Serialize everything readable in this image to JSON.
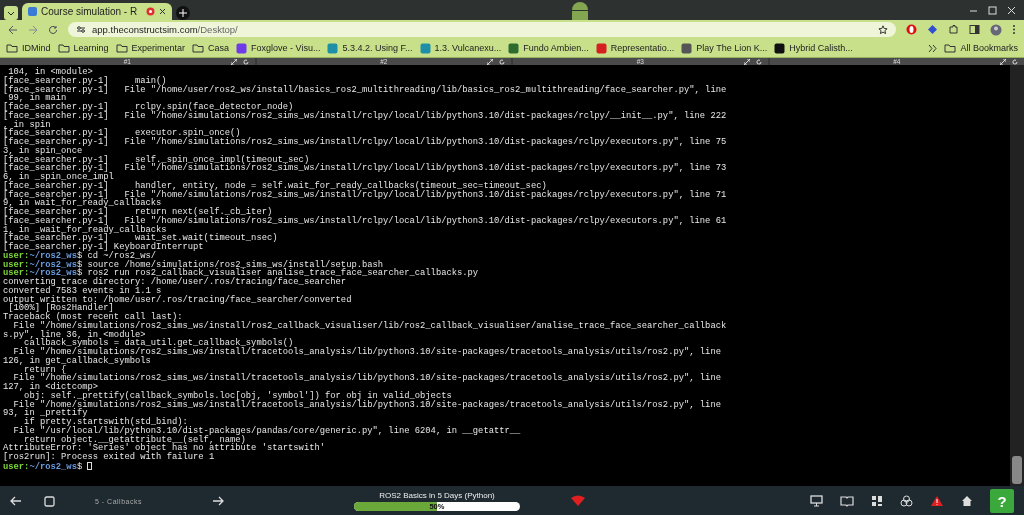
{
  "browser": {
    "tabs": [
      {
        "title": "Course simulation - R",
        "selected": true
      }
    ],
    "url_host": "app.theconstructsim.com",
    "url_path": "/Desktop/",
    "bookmarks": [
      {
        "label": "IDMind",
        "kind": "folder"
      },
      {
        "label": "Learning",
        "kind": "folder"
      },
      {
        "label": "Experimentar",
        "kind": "folder"
      },
      {
        "label": "Casa",
        "kind": "folder"
      },
      {
        "label": "Foxglove - Visu...",
        "kind": "site",
        "color": "#6f3be8"
      },
      {
        "label": "5.3.4.2. Using F...",
        "kind": "site",
        "color": "#1f8fa8"
      },
      {
        "label": "1.3. Vulcanexu...",
        "kind": "site",
        "color": "#1f8fa8"
      },
      {
        "label": "Fundo Ambien...",
        "kind": "site",
        "color": "#2e6b2e"
      },
      {
        "label": "Representatio...",
        "kind": "site",
        "color": "#d42020"
      },
      {
        "label": "Play The Lion K...",
        "kind": "site",
        "color": "#555555"
      },
      {
        "label": "Hybrid Calisth...",
        "kind": "site",
        "color": "#111111"
      }
    ],
    "all_bookmarks": "All Bookmarks"
  },
  "terminal_tabs": [
    {
      "label": "#1"
    },
    {
      "label": "#2"
    },
    {
      "label": "#3"
    },
    {
      "label": "#4"
    }
  ],
  "terminal": {
    "lines": [
      {
        "kind": "output",
        "text": " 104, in <module>"
      },
      {
        "kind": "output",
        "text": "[face_searcher.py-1]     main()"
      },
      {
        "kind": "output",
        "text": "[face_searcher.py-1]   File \"/home/user/ros2_ws/install/basics_ros2_multithreading/lib/basics_ros2_multithreading/face_searcher.py\", line"
      },
      {
        "kind": "output",
        "text": " 99, in main"
      },
      {
        "kind": "output",
        "text": "[face_searcher.py-1]     rclpy.spin(face_detector_node)"
      },
      {
        "kind": "output",
        "text": "[face_searcher.py-1]   File \"/home/simulations/ros2_sims_ws/install/rclpy/local/lib/python3.10/dist-packages/rclpy/__init__.py\", line 222"
      },
      {
        "kind": "output",
        "text": ", in spin"
      },
      {
        "kind": "output",
        "text": "[face_searcher.py-1]     executor.spin_once()"
      },
      {
        "kind": "output",
        "text": "[face_searcher.py-1]   File \"/home/simulations/ros2_sims_ws/install/rclpy/local/lib/python3.10/dist-packages/rclpy/executors.py\", line 75"
      },
      {
        "kind": "output",
        "text": "3, in spin_once"
      },
      {
        "kind": "output",
        "text": "[face_searcher.py-1]     self._spin_once_impl(timeout_sec)"
      },
      {
        "kind": "output",
        "text": "[face_searcher.py-1]   File \"/home/simulations/ros2_sims_ws/install/rclpy/local/lib/python3.10/dist-packages/rclpy/executors.py\", line 73"
      },
      {
        "kind": "output",
        "text": "6, in _spin_once_impl"
      },
      {
        "kind": "output",
        "text": "[face_searcher.py-1]     handler, entity, node = self.wait_for_ready_callbacks(timeout_sec=timeout_sec)"
      },
      {
        "kind": "output",
        "text": "[face_searcher.py-1]   File \"/home/simulations/ros2_sims_ws/install/rclpy/local/lib/python3.10/dist-packages/rclpy/executors.py\", line 71"
      },
      {
        "kind": "output",
        "text": "9, in wait_for_ready_callbacks"
      },
      {
        "kind": "output",
        "text": "[face_searcher.py-1]     return next(self._cb_iter)"
      },
      {
        "kind": "output",
        "text": "[face_searcher.py-1]   File \"/home/simulations/ros2_sims_ws/install/rclpy/local/lib/python3.10/dist-packages/rclpy/executors.py\", line 61"
      },
      {
        "kind": "output",
        "text": "1, in _wait_for_ready_callbacks"
      },
      {
        "kind": "output",
        "text": "[face_searcher.py-1]     wait_set.wait(timeout_nsec)"
      },
      {
        "kind": "output",
        "text": "[face_searcher.py-1] KeyboardInterrupt"
      },
      {
        "kind": "prompt",
        "user": "user:",
        "path": "~/ros2_ws",
        "command": "$ cd ~/ros2_ws/"
      },
      {
        "kind": "prompt",
        "user": "user:",
        "path": "~/ros2_ws",
        "command": "$ source /home/simulations/ros2_sims_ws/install/setup.bash"
      },
      {
        "kind": "prompt",
        "user": "user:",
        "path": "~/ros2_ws",
        "command": "$ ros2 run ros2_callback_visualiser analise_trace_face_searcher_callbacks.py"
      },
      {
        "kind": "output",
        "text": "converting trace directory: /home/user/.ros/tracing/face_searcher"
      },
      {
        "kind": "output",
        "text": "converted 7583 events in 1.1 s"
      },
      {
        "kind": "output",
        "text": "output written to: /home/user/.ros/tracing/face_searcher/converted"
      },
      {
        "kind": "output",
        "text": " [100%] [Ros2Handler]"
      },
      {
        "kind": "output",
        "text": "Traceback (most recent call last):"
      },
      {
        "kind": "output",
        "text": "  File \"/home/simulations/ros2_sims_ws/install/ros2_callback_visualiser/lib/ros2_callback_visualiser/analise_trace_face_searcher_callback"
      },
      {
        "kind": "output",
        "text": "s.py\", line 36, in <module>"
      },
      {
        "kind": "output",
        "text": "    callback_symbols = data_util.get_callback_symbols()"
      },
      {
        "kind": "output",
        "text": "  File \"/home/simulations/ros2_sims_ws/install/tracetools_analysis/lib/python3.10/site-packages/tracetools_analysis/utils/ros2.py\", line"
      },
      {
        "kind": "output",
        "text": "126, in get_callback_symbols"
      },
      {
        "kind": "output",
        "text": "    return {"
      },
      {
        "kind": "output",
        "text": "  File \"/home/simulations/ros2_sims_ws/install/tracetools_analysis/lib/python3.10/site-packages/tracetools_analysis/utils/ros2.py\", line"
      },
      {
        "kind": "output",
        "text": "127, in <dictcomp>"
      },
      {
        "kind": "output",
        "text": "    obj: self._prettify(callback_symbols.loc[obj, 'symbol']) for obj in valid_objects"
      },
      {
        "kind": "output",
        "text": "  File \"/home/simulations/ros2_sims_ws/install/tracetools_analysis/lib/python3.10/site-packages/tracetools_analysis/utils/ros2.py\", line"
      },
      {
        "kind": "output",
        "text": "93, in _prettify"
      },
      {
        "kind": "output",
        "text": "    if pretty.startswith(std_bind):"
      },
      {
        "kind": "output",
        "text": "  File \"/usr/local/lib/python3.10/dist-packages/pandas/core/generic.py\", line 6204, in __getattr__"
      },
      {
        "kind": "output",
        "text": "    return object.__getattribute__(self, name)"
      },
      {
        "kind": "output",
        "text": "AttributeError: 'Series' object has no attribute 'startswith'"
      },
      {
        "kind": "output",
        "text": "[ros2run]: Process exited with failure 1"
      },
      {
        "kind": "prompt",
        "user": "user:",
        "path": "~/ros2_ws",
        "command": "$ ",
        "cursor": true
      }
    ]
  },
  "bottom_bar": {
    "unit": "5 - Callbacks",
    "course": "ROS2 Basics in 5 Days (Python)",
    "progress": {
      "level": 0.5,
      "label": "50%"
    },
    "help": "?"
  }
}
